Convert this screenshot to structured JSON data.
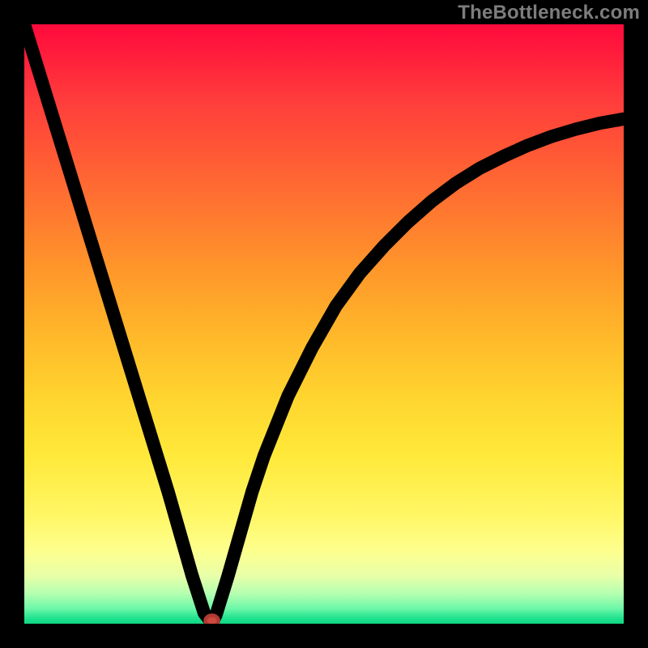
{
  "watermark": "TheBottleneck.com",
  "colors": {
    "page_bg": "#000000",
    "top": "#ff0a3c",
    "mid": "#ffd42e",
    "bottom": "#10d684",
    "curve": "#000000",
    "dot": "#cc4a3f"
  },
  "chart_data": {
    "type": "line",
    "title": "",
    "xlabel": "",
    "ylabel": "",
    "xlim": [
      0,
      100
    ],
    "ylim": [
      0,
      100
    ],
    "series": [
      {
        "name": "bottleneck-curve",
        "x": [
          0,
          2,
          4,
          6,
          8,
          10,
          12,
          14,
          16,
          18,
          20,
          22,
          24,
          26,
          28,
          30,
          31,
          31.5,
          32,
          34,
          36,
          38,
          40,
          44,
          48,
          52,
          56,
          60,
          64,
          68,
          72,
          76,
          80,
          84,
          88,
          92,
          96,
          100
        ],
        "y": [
          100,
          93.5,
          87,
          80.5,
          74,
          67.5,
          61,
          54.5,
          48,
          41.5,
          35,
          28.5,
          22,
          15,
          8,
          1.8,
          0.5,
          0.5,
          1.5,
          8,
          15,
          22,
          28,
          38,
          46,
          53,
          58.5,
          63,
          67,
          70.5,
          73.5,
          76,
          78,
          79.8,
          81.3,
          82.5,
          83.5,
          84.2
        ]
      }
    ],
    "annotations": [
      {
        "name": "min-dot",
        "x": 31.3,
        "y": 0.5
      }
    ]
  }
}
